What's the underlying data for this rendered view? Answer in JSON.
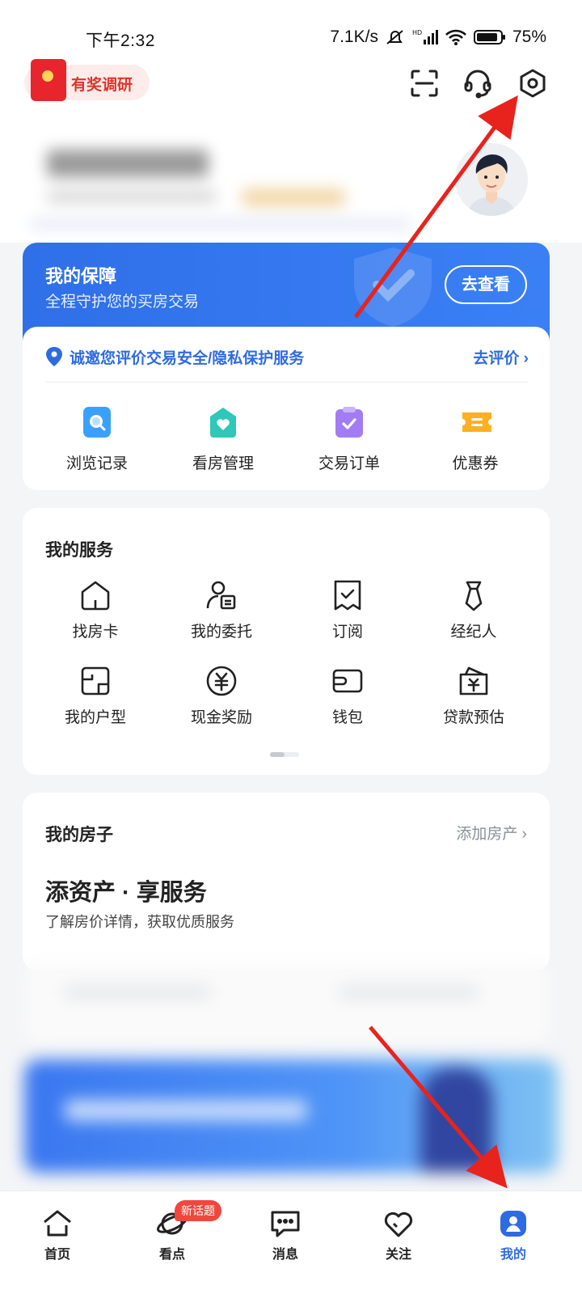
{
  "status_bar": {
    "time": "下午2:32",
    "net_speed": "7.1K/s",
    "battery": "75%"
  },
  "header": {
    "survey_label": "有奖调研",
    "icons": [
      "scan-icon",
      "customer-service-icon",
      "settings-icon"
    ]
  },
  "guarantee": {
    "title": "我的保障",
    "subtitle": "全程守护您的买房交易",
    "button": "去查看",
    "invite_text": "诚邀您评价交易安全/隐私保护服务",
    "invite_link": "去评价",
    "quick_items": [
      {
        "label": "浏览记录",
        "icon": "browse-history-icon",
        "color": "#3aa0ff"
      },
      {
        "label": "看房管理",
        "icon": "viewing-manage-icon",
        "color": "#2ec7b8"
      },
      {
        "label": "交易订单",
        "icon": "trade-order-icon",
        "color": "#a27cf5"
      },
      {
        "label": "优惠券",
        "icon": "coupon-icon",
        "color": "#ffb020"
      }
    ]
  },
  "services": {
    "title": "我的服务",
    "items": [
      {
        "label": "找房卡",
        "icon": "house-card-icon"
      },
      {
        "label": "我的委托",
        "icon": "entrust-icon"
      },
      {
        "label": "订阅",
        "icon": "subscribe-icon"
      },
      {
        "label": "经纪人",
        "icon": "agent-icon"
      },
      {
        "label": "我的户型",
        "icon": "floorplan-icon"
      },
      {
        "label": "现金奖励",
        "icon": "cash-reward-icon"
      },
      {
        "label": "钱包",
        "icon": "wallet-icon"
      },
      {
        "label": "贷款预估",
        "icon": "loan-estimate-icon"
      }
    ]
  },
  "house": {
    "title": "我的房子",
    "add_link": "添加房产",
    "headline": "添资产 · 享服务",
    "desc": "了解房价详情，获取优质服务"
  },
  "tabbar": {
    "items": [
      {
        "label": "首页",
        "icon": "home-icon"
      },
      {
        "label": "看点",
        "icon": "discover-icon"
      },
      {
        "label": "消息",
        "icon": "message-icon"
      },
      {
        "label": "关注",
        "icon": "heart-icon"
      },
      {
        "label": "我的",
        "icon": "profile-icon"
      }
    ],
    "active": "我的",
    "badge": "新话题"
  },
  "colors": {
    "accent": "#2f6be0",
    "guarantee_bg": "#3577ee",
    "annotation_arrow": "#e8231d"
  }
}
